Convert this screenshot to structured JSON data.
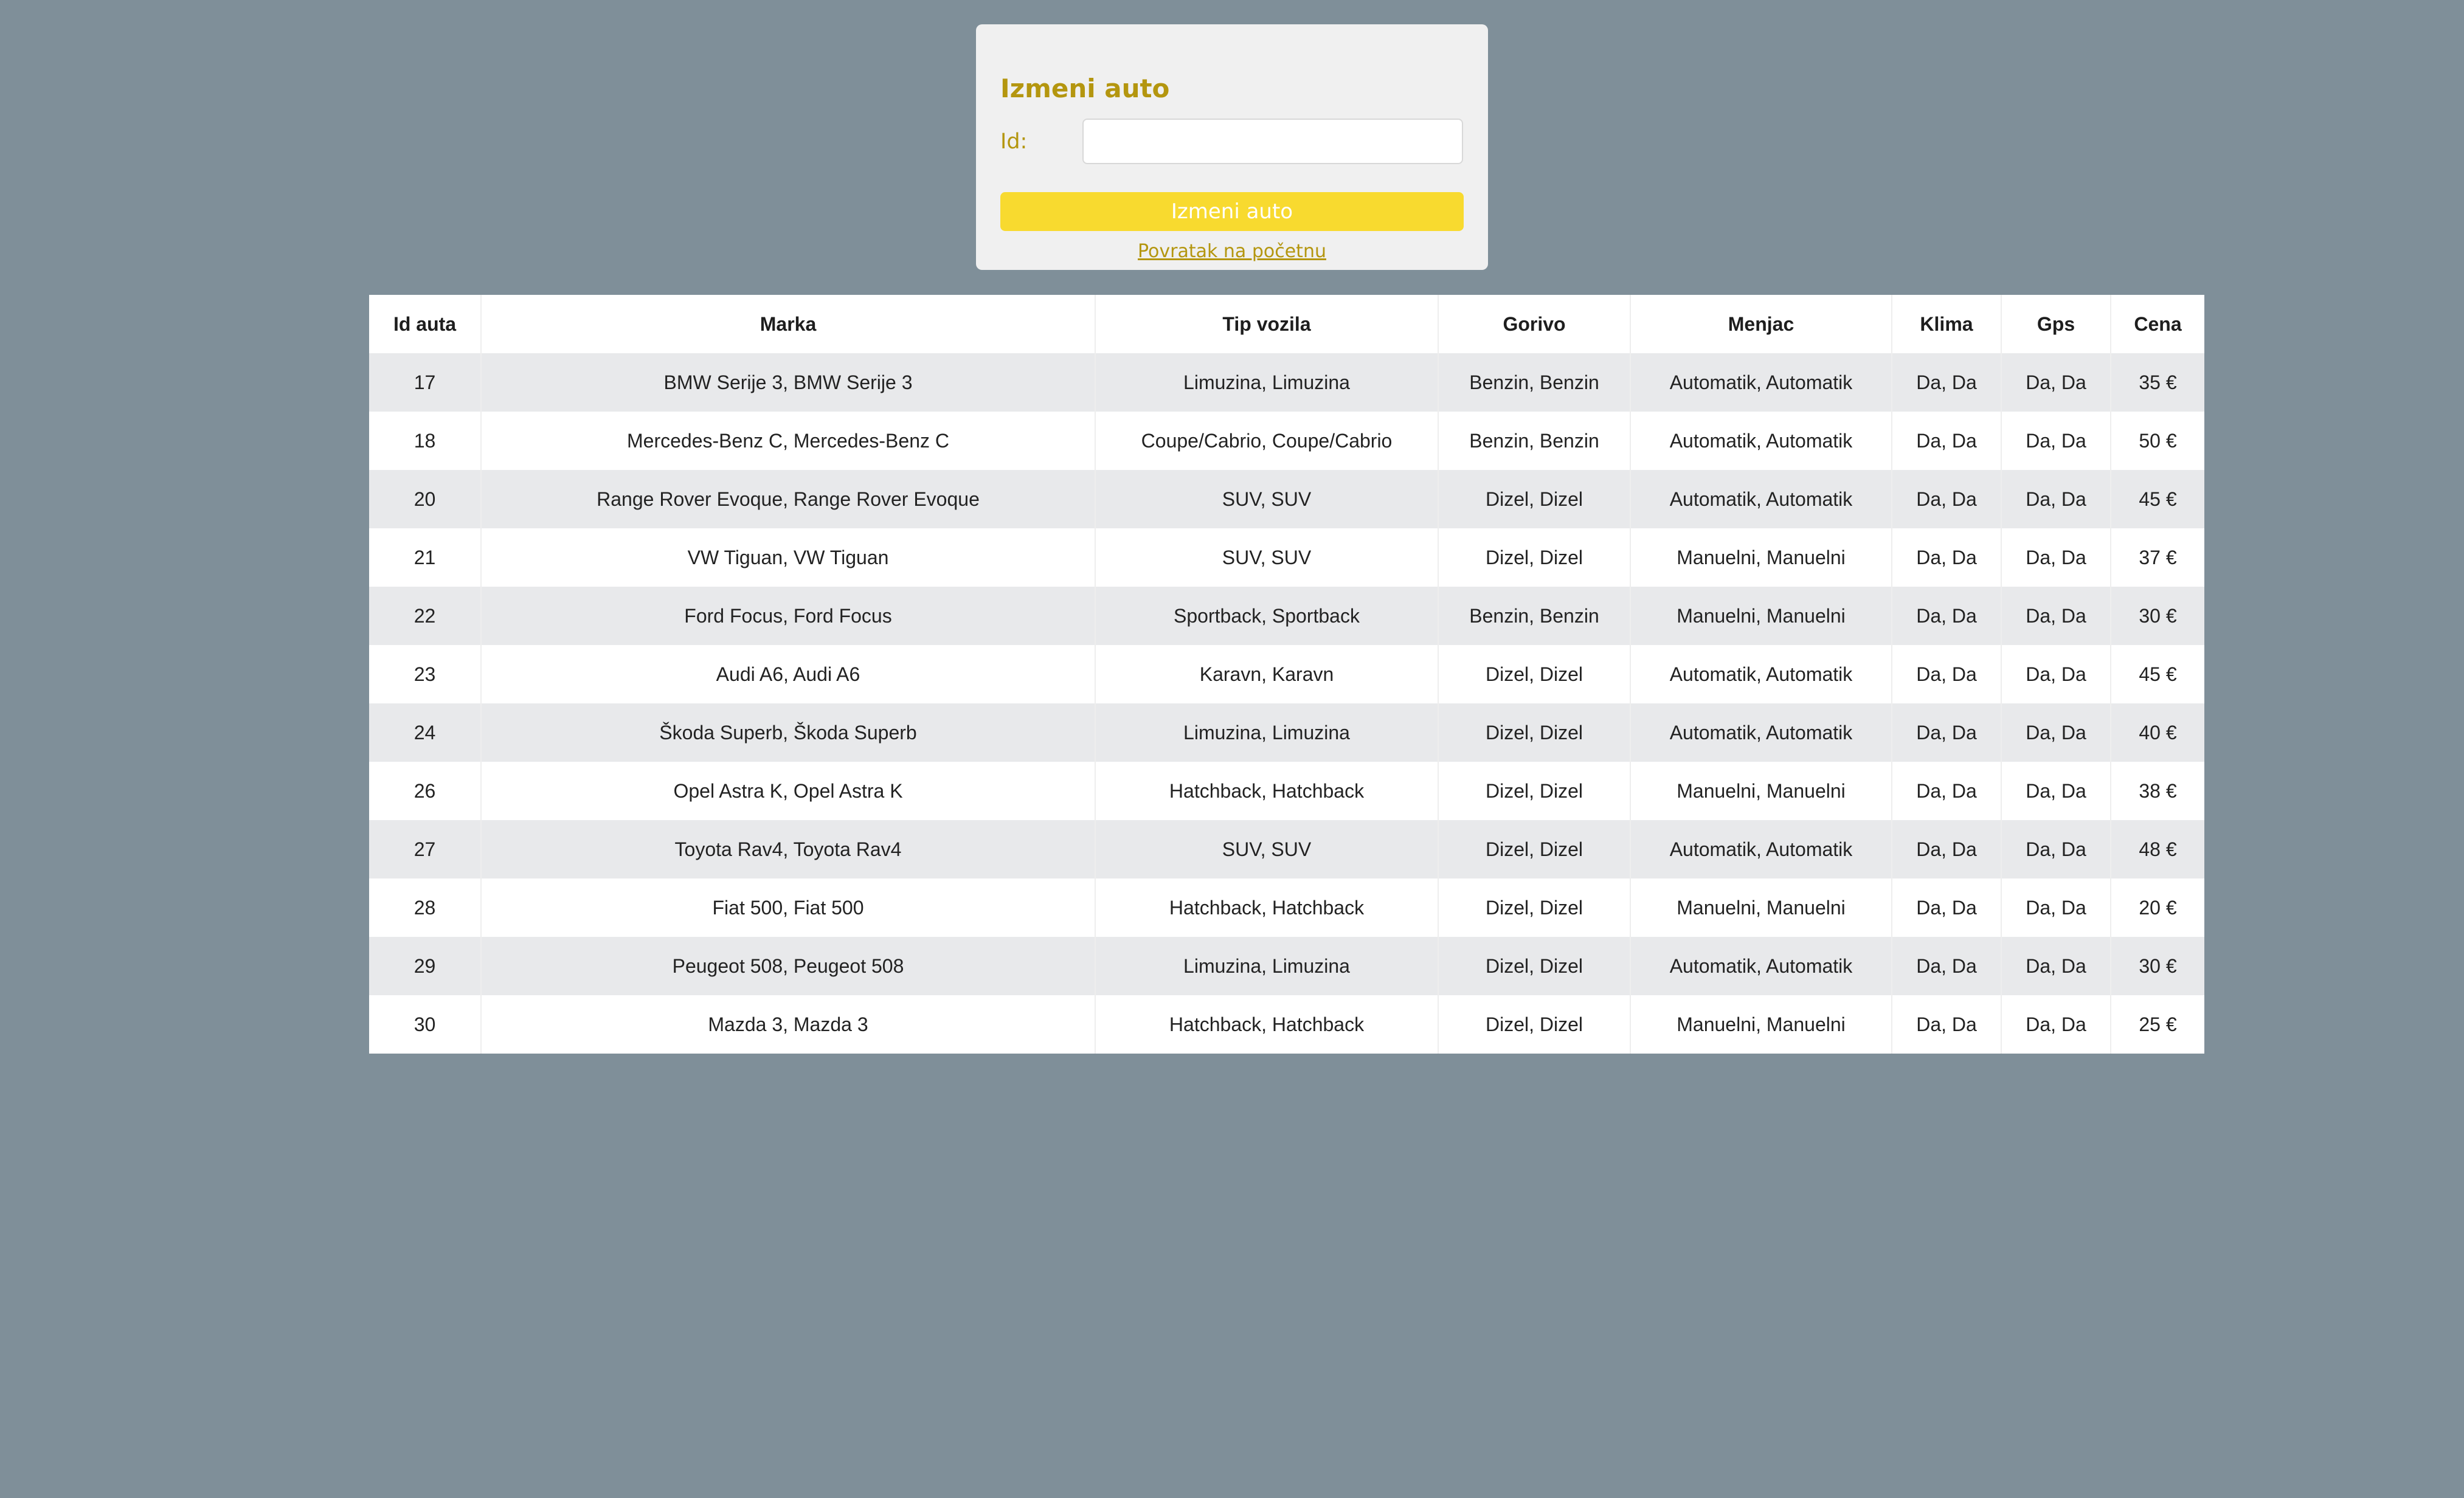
{
  "form": {
    "title": "Izmeni auto",
    "id_label": "Id:",
    "id_value": "",
    "id_placeholder": "",
    "submit_label": "Izmeni auto",
    "back_link": "Povratak na početnu"
  },
  "colors": {
    "background": "#7f8f99",
    "accent_text": "#b4960f",
    "button": "#f8da2f"
  },
  "table": {
    "headers": [
      "Id auta",
      "Marka",
      "Tip vozila",
      "Gorivo",
      "Menjac",
      "Klima",
      "Gps",
      "Cena"
    ],
    "rows": [
      [
        "17",
        "BMW Serije 3, BMW Serije 3",
        "Limuzina, Limuzina",
        "Benzin, Benzin",
        "Automatik, Automatik",
        "Da, Da",
        "Da, Da",
        "35 €"
      ],
      [
        "18",
        "Mercedes-Benz C, Mercedes-Benz C",
        "Coupe/Cabrio, Coupe/Cabrio",
        "Benzin, Benzin",
        "Automatik, Automatik",
        "Da, Da",
        "Da, Da",
        "50 €"
      ],
      [
        "20",
        "Range Rover Evoque, Range Rover Evoque",
        "SUV, SUV",
        "Dizel, Dizel",
        "Automatik, Automatik",
        "Da, Da",
        "Da, Da",
        "45 €"
      ],
      [
        "21",
        "VW Tiguan, VW Tiguan",
        "SUV, SUV",
        "Dizel, Dizel",
        "Manuelni, Manuelni",
        "Da, Da",
        "Da, Da",
        "37 €"
      ],
      [
        "22",
        "Ford Focus, Ford Focus",
        "Sportback, Sportback",
        "Benzin, Benzin",
        "Manuelni, Manuelni",
        "Da, Da",
        "Da, Da",
        "30 €"
      ],
      [
        "23",
        "Audi A6, Audi A6",
        "Karavn, Karavn",
        "Dizel, Dizel",
        "Automatik, Automatik",
        "Da, Da",
        "Da, Da",
        "45 €"
      ],
      [
        "24",
        "Škoda Superb, Škoda Superb",
        "Limuzina, Limuzina",
        "Dizel, Dizel",
        "Automatik, Automatik",
        "Da, Da",
        "Da, Da",
        "40 €"
      ],
      [
        "26",
        "Opel Astra K, Opel Astra K",
        "Hatchback, Hatchback",
        "Dizel, Dizel",
        "Manuelni, Manuelni",
        "Da, Da",
        "Da, Da",
        "38 €"
      ],
      [
        "27",
        "Toyota Rav4, Toyota Rav4",
        "SUV, SUV",
        "Dizel, Dizel",
        "Automatik, Automatik",
        "Da, Da",
        "Da, Da",
        "48 €"
      ],
      [
        "28",
        "Fiat 500, Fiat 500",
        "Hatchback, Hatchback",
        "Dizel, Dizel",
        "Manuelni, Manuelni",
        "Da, Da",
        "Da, Da",
        "20 €"
      ],
      [
        "29",
        "Peugeot 508, Peugeot 508",
        "Limuzina, Limuzina",
        "Dizel, Dizel",
        "Automatik, Automatik",
        "Da, Da",
        "Da, Da",
        "30 €"
      ],
      [
        "30",
        "Mazda 3, Mazda 3",
        "Hatchback, Hatchback",
        "Dizel, Dizel",
        "Manuelni, Manuelni",
        "Da, Da",
        "Da, Da",
        "25 €"
      ]
    ]
  }
}
